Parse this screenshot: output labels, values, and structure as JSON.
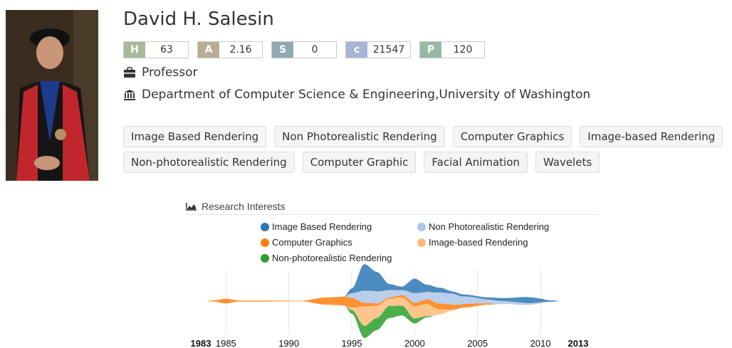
{
  "profile": {
    "name": "David H. Salesin",
    "position": "Professor",
    "affiliation": "Department of Computer Science & Engineering,University of Washington"
  },
  "metrics": [
    {
      "key": "H",
      "value": "63",
      "color": "#a7b99a"
    },
    {
      "key": "A",
      "value": "2.16",
      "color": "#b8ad95"
    },
    {
      "key": "S",
      "value": "0",
      "color": "#8faab1"
    },
    {
      "key": "c",
      "value": "21547",
      "color": "#a9b4d6"
    },
    {
      "key": "P",
      "value": "120",
      "color": "#96b9a6"
    }
  ],
  "tags_row1": [
    "Image Based Rendering",
    "Non Photorealistic Rendering",
    "Computer Graphics",
    "Image-based Rendering"
  ],
  "tags_row2": [
    "Non-photorealistic Rendering",
    "Computer Graphic",
    "Facial Animation",
    "Wavelets"
  ],
  "research_interests": {
    "title": "Research Interests",
    "legend": [
      {
        "label": "Image Based Rendering",
        "color": "#2b77b4"
      },
      {
        "label": "Non Photorealistic Rendering",
        "color": "#aec7e8"
      },
      {
        "label": "Computer Graphics",
        "color": "#ff7f0e"
      },
      {
        "label": "Image-based Rendering",
        "color": "#ffbb78"
      },
      {
        "label": "Non-photorealistic Rendering",
        "color": "#2ca02c"
      }
    ],
    "axis_labels": [
      "1983",
      "1985",
      "1990",
      "1995",
      "2000",
      "2005",
      "2010",
      "2013"
    ],
    "axis_bold": [
      "1983",
      "2013"
    ]
  },
  "chart_data": {
    "type": "area",
    "title": "Research Interests",
    "x_range": [
      1983,
      2013
    ],
    "series": [
      {
        "name": "Image Based Rendering",
        "values": [
          [
            1995,
            0.4
          ],
          [
            1996,
            2.2
          ],
          [
            1997,
            1.6
          ],
          [
            1998,
            0.5
          ],
          [
            1999,
            0.3
          ],
          [
            2000,
            1.2
          ],
          [
            2001,
            0.6
          ],
          [
            2002,
            0.4
          ],
          [
            2003,
            0.2
          ],
          [
            2005,
            0.15
          ],
          [
            2007,
            0.25
          ],
          [
            2009,
            0.5
          ],
          [
            2011,
            0.1
          ]
        ]
      },
      {
        "name": "Non Photorealistic Rendering",
        "values": [
          [
            1995,
            0.4
          ],
          [
            1996,
            1.0
          ],
          [
            1997,
            1.0
          ],
          [
            1998,
            0.6
          ],
          [
            1999,
            0.4
          ],
          [
            2000,
            0.8
          ],
          [
            2001,
            0.6
          ],
          [
            2002,
            0.9
          ],
          [
            2003,
            0.9
          ],
          [
            2004,
            0.6
          ],
          [
            2006,
            0.3
          ],
          [
            2008,
            0.2
          ],
          [
            2010,
            0.1
          ]
        ]
      },
      {
        "name": "Computer Graphics",
        "values": [
          [
            1984,
            0.1
          ],
          [
            1985,
            0.4
          ],
          [
            1986,
            0.1
          ],
          [
            1991,
            0.05
          ],
          [
            1993,
            0.6
          ],
          [
            1995,
            0.8
          ],
          [
            1996,
            0.3
          ],
          [
            1998,
            0.1
          ],
          [
            2000,
            0.3
          ],
          [
            2002,
            0.5
          ],
          [
            2004,
            0.3
          ],
          [
            2006,
            0.1
          ]
        ]
      },
      {
        "name": "Image-based Rendering",
        "values": [
          [
            1995,
            0.2
          ],
          [
            1996,
            1.6
          ],
          [
            1997,
            1.0
          ],
          [
            1998,
            0.6
          ],
          [
            1999,
            0.7
          ],
          [
            2000,
            1.0
          ],
          [
            2001,
            1.0
          ],
          [
            2002,
            0.4
          ],
          [
            2003,
            0.1
          ]
        ]
      },
      {
        "name": "Non-photorealistic Rendering",
        "values": [
          [
            1995,
            0.3
          ],
          [
            1996,
            1.0
          ],
          [
            1997,
            1.0
          ],
          [
            1998,
            1.0
          ],
          [
            1999,
            0.8
          ],
          [
            2000,
            0.4
          ],
          [
            2001,
            0.1
          ]
        ]
      }
    ]
  }
}
